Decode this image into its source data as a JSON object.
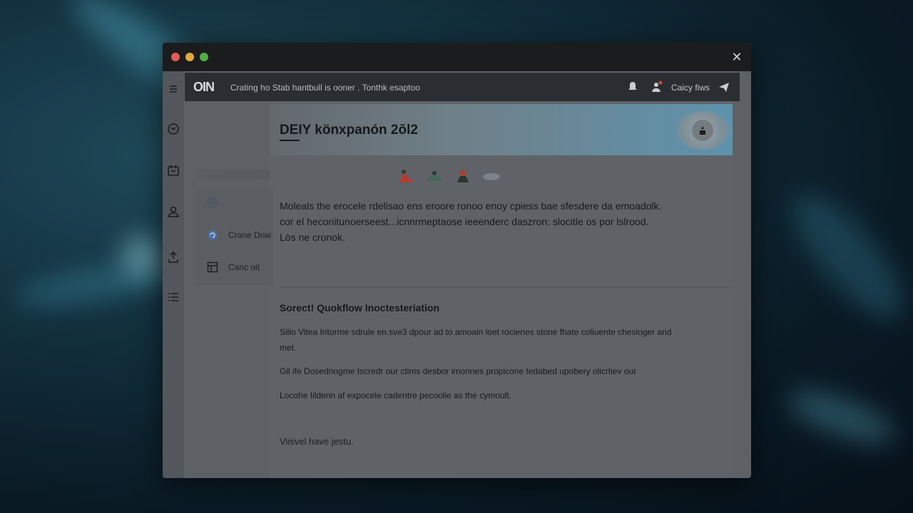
{
  "topbar": {
    "logo": "OIN",
    "title": "Crating ho Stab hantbull is ooner . Tonthk esaptoo",
    "user_label": "Caicy fiws"
  },
  "dropdown": {
    "items": [
      {
        "label": "",
        "icon": "globe-icon"
      },
      {
        "label": "Crane Dnw",
        "icon": "refresh-icon"
      },
      {
        "label": "Canc oit",
        "icon": "layout-icon"
      }
    ]
  },
  "banner": {
    "title": "DEIY könxpanón 2ŏl2"
  },
  "content": {
    "line1": "Moleals the erocele rdelisao ens eroore ronoo enoy cpiess bae sfesdere da emoadolk.",
    "line2": "cor el heconitunoerseest...icnnrmeptaose ieeenderc daszron:  slocitle os por lslrood.",
    "line3": "Lòs ne cronok.",
    "section_title": "Sorect! Quokflow Inoctesteriation",
    "para1a": "Sillo Vitea Intorme sdrule en.sve3 dpour ad to amoain loet rocienes stone fhate coliuente chesloger and",
    "para1b": "met.",
    "para2": "Gil ife Dosednogme Iscredr our ctims desbor imonnes propicone tedabed upobery olicrtiev our",
    "para3": "Locohe Iildenn af expocele cadentre pecoolie as the cymoult.",
    "signoff": "Viisvel have jestu."
  },
  "colors": {
    "window_bg": "#5d6165",
    "titlebar_bg": "#1b1c1e",
    "topbar_bg": "#2a2d31",
    "banner_accent": "#5e93ad",
    "traffic_red": "#e35c57",
    "traffic_yellow": "#e0a93a",
    "traffic_green": "#4fb043"
  }
}
